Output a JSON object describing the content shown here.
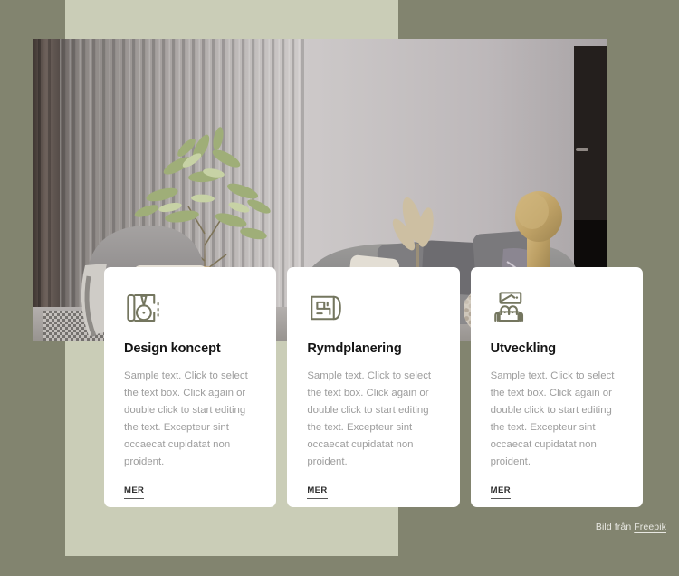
{
  "page": {
    "background_color": "#82846f",
    "panel_color": "#cacdb7"
  },
  "hero": {
    "image_alt": "Modern living room interior with slatted wall panels, olive tree, grey sofa and armchair"
  },
  "cards": [
    {
      "icon": "design-concept-icon",
      "title": "Design koncept",
      "body": "Sample text. Click to select the text box. Click again or double click to start editing the text. Excepteur sint occaecat cupidatat non proident.",
      "link_label": "MER"
    },
    {
      "icon": "floor-plan-icon",
      "title": "Rymdplanering",
      "body": "Sample text. Click to select the text box. Click again or double click to start editing the text. Excepteur sint occaecat cupidatat non proident.",
      "link_label": "MER"
    },
    {
      "icon": "sofa-icon",
      "title": "Utveckling",
      "body": "Sample text. Click to select the text box. Click again or double click to start editing the text. Excepteur sint occaecat cupidatat non proident.",
      "link_label": "MER"
    }
  ],
  "attribution": {
    "prefix": "Bild från ",
    "link_label": "Freepik"
  },
  "colors": {
    "icon": "#74765f",
    "heading": "#141414",
    "body_text": "#9d9d9d",
    "link": "#2f2f2f"
  }
}
